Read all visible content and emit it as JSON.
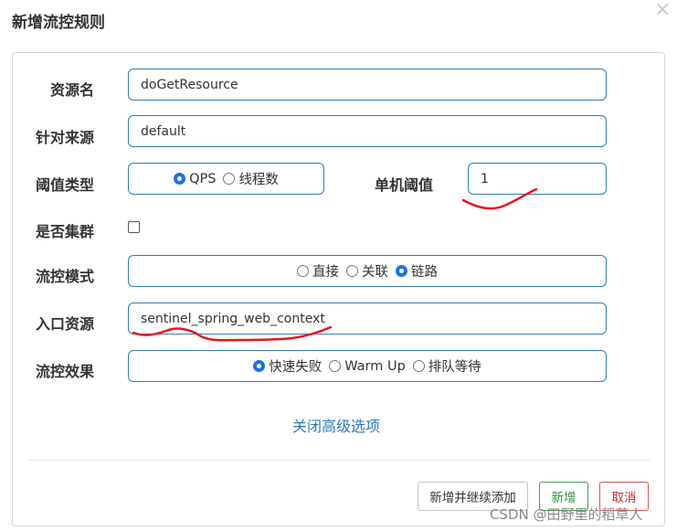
{
  "dialog": {
    "title": "新增流控规则",
    "close_symbol": "×"
  },
  "form": {
    "resource_label": "资源名",
    "resource_value": "doGetResource",
    "source_label": "针对来源",
    "source_value": "default",
    "threshold_type_label": "阈值类型",
    "threshold_type_options": [
      "QPS",
      "线程数"
    ],
    "threshold_type_selected": "QPS",
    "single_threshold_label": "单机阈值",
    "single_threshold_value": "1",
    "cluster_label": "是否集群",
    "cluster_checked": false,
    "mode_label": "流控模式",
    "mode_options": [
      "直接",
      "关联",
      "链路"
    ],
    "mode_selected": "链路",
    "entry_resource_label": "入口资源",
    "entry_resource_value": "sentinel_spring_web_context",
    "effect_label": "流控效果",
    "effect_options": [
      "快速失败",
      "Warm Up",
      "排队等待"
    ],
    "effect_selected": "快速失败",
    "advanced_toggle": "关闭高级选项"
  },
  "footer": {
    "add_continue_label": "新增并继续添加",
    "add_label": "新增",
    "cancel_label": "取消"
  },
  "watermark": "CSDN @田野里的稻草人",
  "colors": {
    "border_blue": "#2e7dbd",
    "radio_blue": "#1a73e8",
    "link_blue": "#2b7bbd",
    "success_green": "#3da351",
    "danger_red": "#d9534f",
    "annotation_red": "#e8141e"
  }
}
